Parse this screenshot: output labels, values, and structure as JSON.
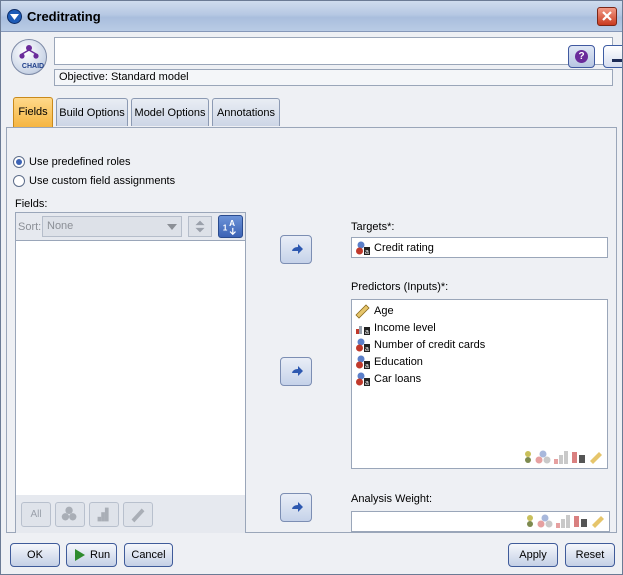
{
  "window": {
    "title": "Creditrating"
  },
  "node": {
    "label": "CHAID",
    "name": "",
    "objective": "Objective: Standard model"
  },
  "tabs": [
    {
      "label": "Fields",
      "active": true
    },
    {
      "label": "Build Options",
      "active": false
    },
    {
      "label": "Model Options",
      "active": false
    },
    {
      "label": "Annotations",
      "active": false
    }
  ],
  "roles": {
    "predefined": "Use predefined roles",
    "custom": "Use custom field assignments",
    "selected": "predefined"
  },
  "fields": {
    "label": "Fields:",
    "sort_label": "Sort:",
    "sort_value": "None",
    "filter_all": "All",
    "items": []
  },
  "targets": {
    "label": "Targets*:",
    "items": [
      {
        "name": "Credit rating",
        "icon": "flag-icon"
      }
    ]
  },
  "predictors": {
    "label": "Predictors (Inputs)*:",
    "items": [
      {
        "name": "Age",
        "icon": "ruler-icon"
      },
      {
        "name": "Income level",
        "icon": "ordinal-icon"
      },
      {
        "name": "Number of credit cards",
        "icon": "nominal-icon"
      },
      {
        "name": "Education",
        "icon": "nominal-icon"
      },
      {
        "name": "Car loans",
        "icon": "nominal-icon"
      }
    ]
  },
  "weight": {
    "label": "Analysis Weight:",
    "value": ""
  },
  "buttons": {
    "ok": "OK",
    "run": "Run",
    "cancel": "Cancel",
    "apply": "Apply",
    "reset": "Reset"
  },
  "colors": {
    "accent": "#3c63b5",
    "tab_active": "#f5b541",
    "close": "#c93a1f"
  }
}
